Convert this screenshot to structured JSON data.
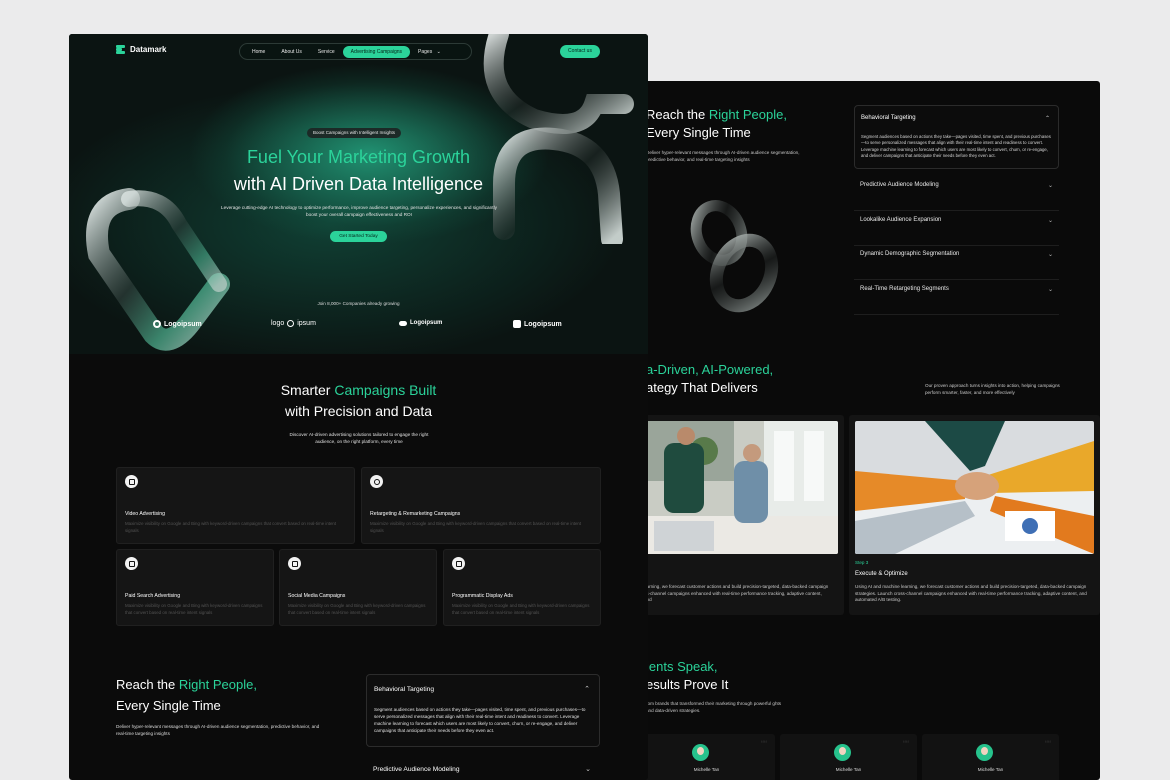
{
  "brand": {
    "name": "Datamark",
    "accent": "#2bd39a",
    "background": "#0b0b0b"
  },
  "nav": {
    "items": [
      {
        "label": "Home",
        "active": false
      },
      {
        "label": "About Us",
        "active": false
      },
      {
        "label": "Service",
        "active": false
      },
      {
        "label": "Advertising Campaigns",
        "active": true
      },
      {
        "label": "Pages",
        "active": false
      }
    ],
    "pages_chevron": "⌄",
    "contact_label": "Contact us"
  },
  "hero": {
    "pill": "Boost Campaigns with Intelligent Insights",
    "title_line1": "Fuel Your Marketing Growth",
    "title_line2": "with AI Driven Data Intelligence",
    "description": "Leverage cutting-edge AI technology to optimize performance, improve audience targeting, personalize experiences, and significantly boost your overall campaign effectiveness and ROI",
    "button": "Get Started Today",
    "join_text": "Join 8,000+ Companies already growing",
    "partner_logos": [
      "Logoipsum",
      "logo",
      "ipsum",
      "Logoipsum",
      "Logoipsum"
    ]
  },
  "services": {
    "title_white": "Smarter ",
    "title_accent": "Campaigns Built",
    "title_line2": "with Precision and Data",
    "description": "Discover AI-driven advertising solutions tailored to engage the right audience, on the right platform, every time",
    "cards": [
      {
        "title": "Video Advertising",
        "desc": "Maximize visibility on Google and Bing with keyword-driven campaigns that convert based on real-time intent signals",
        "icon": "video-icon"
      },
      {
        "title": "Retargeting & Remarketing Campaigns",
        "desc": "Maximize visibility on Google and Bing with keyword-driven campaigns that convert based on real-time intent signals",
        "icon": "target-icon"
      },
      {
        "title": "Paid Search Advertising",
        "desc": "Maximize visibility on Google and Bing with keyword-driven campaigns that convert based on real-time intent signals",
        "icon": "search-ad-icon"
      },
      {
        "title": "Social Media Campaigns",
        "desc": "Maximize visibility on Google and Bing with keyword-driven campaigns that convert based on real-time intent signals",
        "icon": "social-icon"
      },
      {
        "title": "Programmatic Display Ads",
        "desc": "Maximize visibility on Google and Bing with keyword-driven campaigns that convert based on real-time intent signals",
        "icon": "display-icon"
      }
    ]
  },
  "reach": {
    "title_white": "Reach the ",
    "title_accent": "Right People,",
    "title_line2": "Every Single Time",
    "description": "Deliver hyper-relevant messages through AI-driven audience segmentation, predictive behavior, and real-time targeting insights",
    "accordion_open": {
      "title": "Behavioral Targeting",
      "chevron": "⌃",
      "body": "Segment audiences based on actions they take—pages visited, time spent, and previous purchases—to serve personalized messages that align with their real-time intent and readiness to convert. Leverage machine learning to forecast which users are most likely to convert, churn, or re-engage, and deliver campaigns that anticipate their needs before they even act."
    },
    "accordion_items": [
      "Predictive Audience Modeling",
      "Lookalike Audience Expansion",
      "Dynamic Demographic Segmentation",
      "Real-Time Retargeting Segments"
    ],
    "chevron": "⌄"
  },
  "strategy": {
    "title_accent": "a-Driven, AI-Powered,",
    "title_line2": "ategy That Delivers",
    "side_text": "Our proven approach turns insights into action, helping campaigns perform smarter, faster, and more effectively",
    "card_left_text": "earning, we forecast customer actions and build precision-targeted, data-backed campaign ss-channel campaigns enhanced with real-time performance tracking, adaptive content, and",
    "step_label": "Step 3",
    "step_title": "Execute & Optimize",
    "step_text": "Using AI and machine learning, we forecast customer actions and build precision-targeted, data-backed campaign strategies. Launch cross-channel campaigns enhanced with real-time performance tracking, adaptive content, and automated A/B testing."
  },
  "testimonials": {
    "title_accent": "ients Speak,",
    "title_line2": "esults Prove It",
    "description": "rom brands that transformed their marketing through powerful ghts and data-driven strategies.",
    "quote_mark": "““",
    "reviewers": [
      "Michelle Tan",
      "Michelle Tan",
      "Michelle Tan"
    ]
  }
}
